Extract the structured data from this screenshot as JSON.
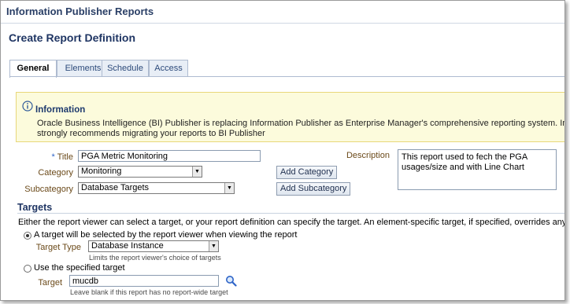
{
  "header": {
    "app_title": "Information Publisher Reports"
  },
  "page": {
    "title": "Create Report Definition"
  },
  "tabs": [
    {
      "label": "General",
      "active": true
    },
    {
      "label": "Elements",
      "active": false
    },
    {
      "label": "Schedule",
      "active": false
    },
    {
      "label": "Access",
      "active": false
    }
  ],
  "info": {
    "title": "Information",
    "line1": "Oracle Business Intelligence (BI) Publisher is replacing Information Publisher as Enterprise Manager's comprehensive reporting system. Information Publish",
    "line2": "strongly recommends migrating your reports to BI Publisher",
    "icon": "info-icon"
  },
  "form": {
    "required_mark": "*",
    "title_label": "Title",
    "title_value": "PGA Metric Monitoring",
    "category_label": "Category",
    "category_value": "Monitoring",
    "subcategory_label": "Subcategory",
    "subcategory_value": "Database Targets",
    "add_category_label": "Add Category",
    "add_subcategory_label": "Add Subcategory",
    "description_label": "Description",
    "description_value": "This report used to fech the PGA usages/size and with Line Chart"
  },
  "targets": {
    "title": "Targets",
    "intro": "Either the report viewer can select a target, or your report definition can specify the target. An element-specific target, if specified, overrides any choice below.",
    "option1_label": "A target will be selected by the report viewer when viewing the report",
    "target_type_label": "Target Type",
    "target_type_value": "Database Instance",
    "target_type_hint": "Limits the report viewer's choice of targets",
    "option2_label": "Use the specified target",
    "target_label": "Target",
    "target_value": "mucdb",
    "target_hint": "Leave blank if this report has no report-wide target"
  },
  "colors": {
    "accent": "#1f3563",
    "info_bg": "#fcfbdc",
    "label": "#6b4a1a"
  }
}
